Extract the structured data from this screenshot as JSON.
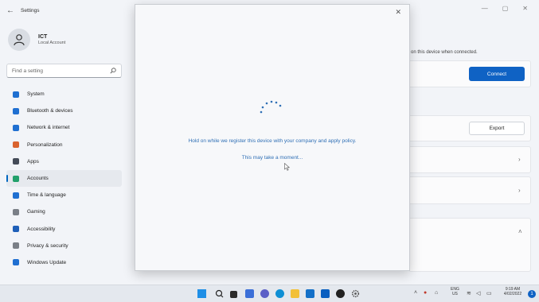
{
  "window": {
    "title": "Settings",
    "minimize": "—",
    "maximize": "▢",
    "close": "✕"
  },
  "profile": {
    "name": "ICT",
    "account_type": "Local Account"
  },
  "search": {
    "placeholder": "Find a setting"
  },
  "nav": {
    "items": [
      {
        "label": "System",
        "icon": "monitor-icon",
        "color": "#1f6fd1"
      },
      {
        "label": "Bluetooth & devices",
        "icon": "bluetooth-icon",
        "color": "#1f6fd1"
      },
      {
        "label": "Network & internet",
        "icon": "wifi-icon",
        "color": "#1f6fd1"
      },
      {
        "label": "Personalization",
        "icon": "brush-icon",
        "color": "#d9632f"
      },
      {
        "label": "Apps",
        "icon": "apps-icon",
        "color": "#444b58"
      },
      {
        "label": "Accounts",
        "icon": "accounts-icon",
        "color": "#22a06b"
      },
      {
        "label": "Time & language",
        "icon": "globe-icon",
        "color": "#1f6fd1"
      },
      {
        "label": "Gaming",
        "icon": "gamepad-icon",
        "color": "#7a7f87"
      },
      {
        "label": "Accessibility",
        "icon": "accessibility-icon",
        "color": "#1f5fb8"
      },
      {
        "label": "Privacy & security",
        "icon": "shield-icon",
        "color": "#7a7f87"
      },
      {
        "label": "Windows Update",
        "icon": "update-icon",
        "color": "#1f6fd1"
      }
    ],
    "active_index": 5
  },
  "right": {
    "connect_text": "on this device when connected.",
    "connect_button": "Connect",
    "export_button": "Export"
  },
  "dialog": {
    "message": "Hold on while we register this device with your company and apply policy.",
    "submessage": "This may take a moment...",
    "close": "✕"
  },
  "taskbar": {
    "lang": "ENG",
    "region": "US",
    "time": "9:19 AM",
    "date": "4/02/2022",
    "notification_count": "1"
  }
}
